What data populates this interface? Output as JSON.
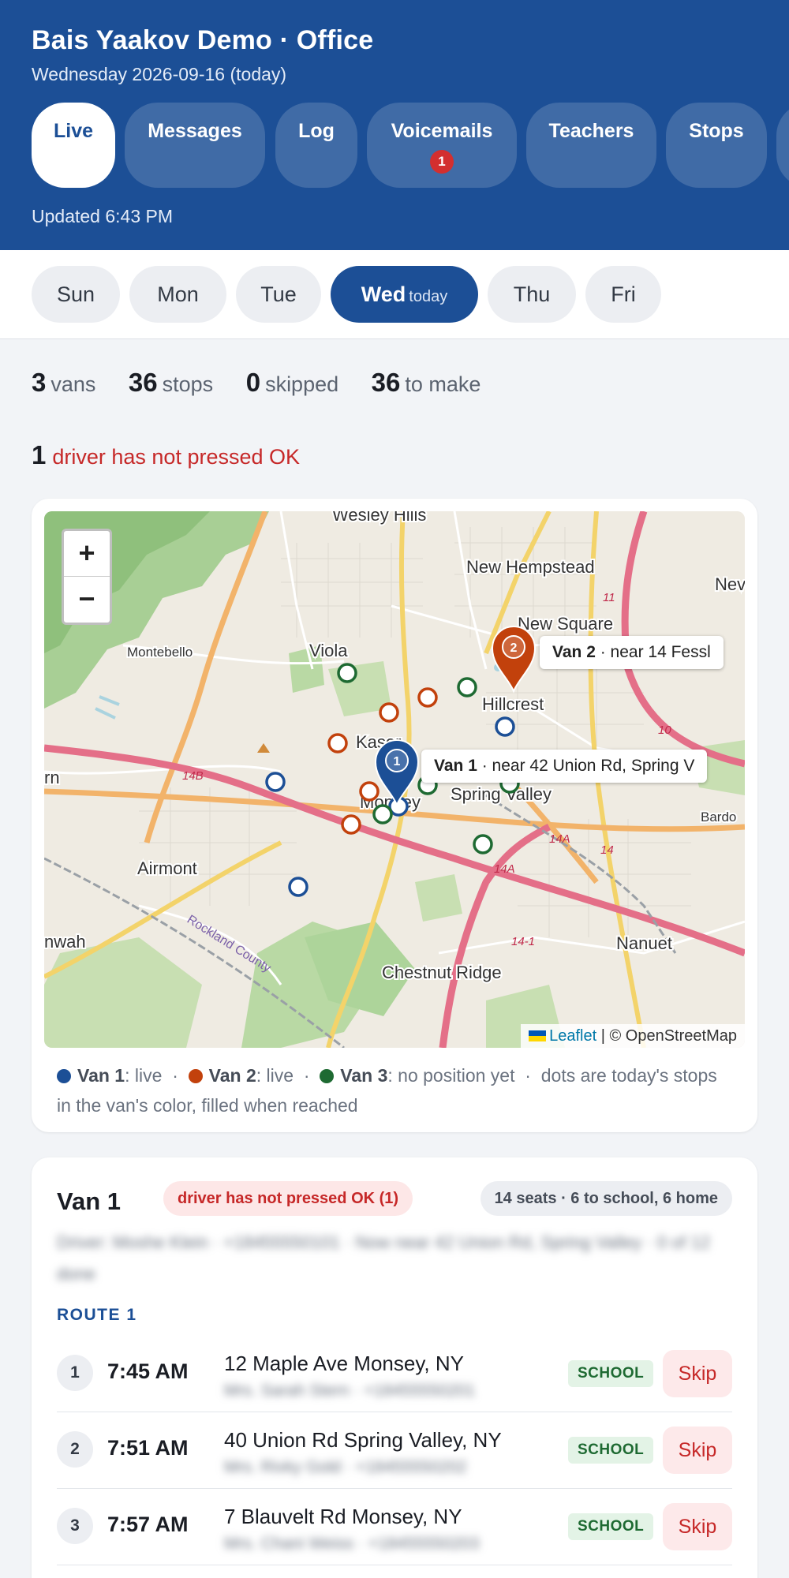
{
  "header": {
    "title": "Bais Yaakov Demo · Office",
    "date": "Wednesday 2026-09-16 (today)",
    "tabs": [
      {
        "label": "Live",
        "active": true
      },
      {
        "label": "Messages"
      },
      {
        "label": "Log"
      },
      {
        "label": "Voicemails",
        "badge": "1"
      },
      {
        "label": "Teachers"
      },
      {
        "label": "Stops"
      }
    ],
    "updated": "Updated 6:43 PM"
  },
  "days": [
    {
      "label": "Sun"
    },
    {
      "label": "Mon"
    },
    {
      "label": "Tue"
    },
    {
      "label": "Wed",
      "tag": "today",
      "active": true
    },
    {
      "label": "Thu"
    },
    {
      "label": "Fri"
    }
  ],
  "stats": {
    "vans": "3",
    "vans_label": "vans",
    "stops": "36",
    "stops_label": "stops",
    "skipped": "0",
    "skipped_label": "skipped",
    "to_make": "36",
    "to_make_label": "to make"
  },
  "alert": {
    "count": "1",
    "text": "driver has not pressed OK"
  },
  "map": {
    "place_labels": [
      "Wesley Hills",
      "New Hempstead",
      "New Square",
      "Viola",
      "Montebello",
      "Hillcrest",
      "Kaser",
      "Monsey",
      "Spring Valley",
      "Airmont",
      "Chestnut Ridge",
      "Nanuet",
      "Bardo",
      "nwah",
      "Rockland County",
      "Nev",
      "rn"
    ],
    "road_labels": [
      "14B",
      "14A",
      "14A",
      "14-1",
      "14",
      "10",
      "11"
    ],
    "van1_marker": "1",
    "van2_marker": "2",
    "van1_label_name": "Van 1",
    "van1_label_text": "· near 42 Union Rd, Spring V",
    "van2_label_name": "Van 2",
    "van2_label_text": "· near 14 Fessl",
    "zoom_in": "+",
    "zoom_out": "−",
    "attribution_leaflet": "Leaflet",
    "attribution_rest": "| © OpenStreetMap"
  },
  "legend": {
    "van1_name": "Van 1",
    "van1_status": ": live",
    "van2_name": "Van 2",
    "van2_status": ": live",
    "van3_name": "Van 3",
    "van3_status": ": no position yet",
    "sep": "·",
    "note": "dots are today's stops in the van's color, filled when reached",
    "colors": {
      "van1": "#1c4f96",
      "van2": "#c2410c",
      "van3": "#1e6a32"
    }
  },
  "van_card": {
    "title": "Van 1",
    "alert": "driver has not pressed OK (1)",
    "capacity": "14 seats · 6 to school, 6 home",
    "info": "Driver: Moshe Klein · +18455550101 · Now near 42 Union Rd, Spring Valley · 0 of 12 done",
    "route_heading": "ROUTE 1",
    "stops": [
      {
        "num": "1",
        "time": "7:45 AM",
        "address": "12 Maple Ave Monsey, NY",
        "sub": "Mrs. Sarah Stern · +18455550201",
        "type": "SCHOOL",
        "action": "Skip"
      },
      {
        "num": "2",
        "time": "7:51 AM",
        "address": "40 Union Rd Spring Valley, NY",
        "sub": "Mrs. Rivky Gold · +18455550202",
        "type": "SCHOOL",
        "action": "Skip"
      },
      {
        "num": "3",
        "time": "7:57 AM",
        "address": "7 Blauvelt Rd Monsey, NY",
        "sub": "Mrs. Chani Weiss · +18455550203",
        "type": "SCHOOL",
        "action": "Skip"
      }
    ]
  }
}
